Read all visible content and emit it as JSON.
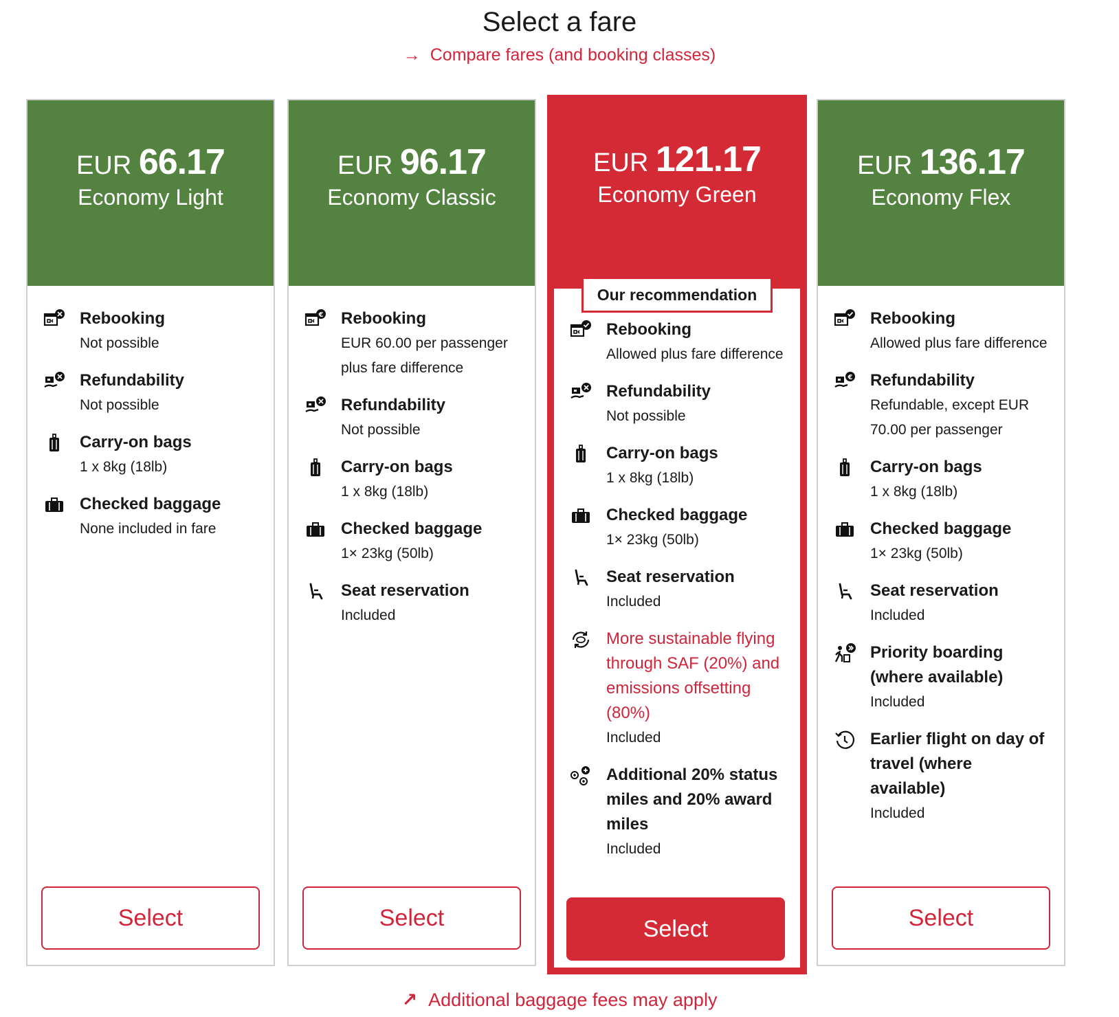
{
  "header": {
    "title": "Select a fare",
    "compare_link": "Compare fares (and booking classes)"
  },
  "fares": [
    {
      "currency": "EUR",
      "amount": "66.17",
      "name": "Economy Light",
      "features": [
        {
          "icon": "calendar-x-icon",
          "title": "Rebooking",
          "desc": "Not possible"
        },
        {
          "icon": "refund-x-icon",
          "title": "Refundability",
          "desc": "Not possible"
        },
        {
          "icon": "suitcase-icon",
          "title": "Carry-on bags",
          "desc": "1 x 8kg (18lb)"
        },
        {
          "icon": "briefcase-icon",
          "title": "Checked baggage",
          "desc": "None included in fare"
        }
      ],
      "button": "Select"
    },
    {
      "currency": "EUR",
      "amount": "96.17",
      "name": "Economy Classic",
      "features": [
        {
          "icon": "calendar-euro-icon",
          "title": "Rebooking",
          "desc": "EUR 60.00 per passenger plus fare difference"
        },
        {
          "icon": "refund-x-icon",
          "title": "Refundability",
          "desc": "Not possible"
        },
        {
          "icon": "suitcase-icon",
          "title": "Carry-on bags",
          "desc": "1 x 8kg (18lb)"
        },
        {
          "icon": "briefcase-icon",
          "title": "Checked baggage",
          "desc": "1× 23kg (50lb)"
        },
        {
          "icon": "seat-icon",
          "title": "Seat reservation",
          "desc": "Included"
        }
      ],
      "button": "Select"
    },
    {
      "currency": "EUR",
      "amount": "121.17",
      "name": "Economy Green",
      "badge": "Our recommendation",
      "features": [
        {
          "icon": "calendar-check-icon",
          "title": "Rebooking",
          "desc": "Allowed plus fare difference"
        },
        {
          "icon": "refund-x-icon",
          "title": "Refundability",
          "desc": "Not possible"
        },
        {
          "icon": "suitcase-icon",
          "title": "Carry-on bags",
          "desc": "1 x 8kg (18lb)"
        },
        {
          "icon": "briefcase-icon",
          "title": "Checked baggage",
          "desc": "1× 23kg (50lb)"
        },
        {
          "icon": "seat-icon",
          "title": "Seat reservation",
          "desc": "Included"
        },
        {
          "icon": "sustainable-icon",
          "title": "More sustainable flying through SAF (20%) and emissions offsetting (80%)",
          "desc": "Included",
          "accent": true
        },
        {
          "icon": "plus-circles-icon",
          "title": "Additional 20% status miles and 20% award miles",
          "desc": "Included"
        }
      ],
      "button": "Select"
    },
    {
      "currency": "EUR",
      "amount": "136.17",
      "name": "Economy Flex",
      "features": [
        {
          "icon": "calendar-check-icon",
          "title": "Rebooking",
          "desc": "Allowed plus fare difference"
        },
        {
          "icon": "refund-euro-icon",
          "title": "Refundability",
          "desc": "Refundable, except EUR 70.00 per passenger"
        },
        {
          "icon": "suitcase-icon",
          "title": "Carry-on bags",
          "desc": "1 x 8kg (18lb)"
        },
        {
          "icon": "briefcase-icon",
          "title": "Checked baggage",
          "desc": "1× 23kg (50lb)"
        },
        {
          "icon": "seat-icon",
          "title": "Seat reservation",
          "desc": "Included"
        },
        {
          "icon": "priority-boarding-icon",
          "title": "Priority boarding (where available)",
          "desc": "Included"
        },
        {
          "icon": "earlier-flight-icon",
          "title": "Earlier flight on day of travel (where available)",
          "desc": "Included"
        }
      ],
      "button": "Select"
    }
  ],
  "footer": {
    "baggage_link": "Additional baggage fees may apply"
  },
  "colors": {
    "green": "#548240",
    "red": "#d42a35",
    "link": "#d0253a"
  }
}
